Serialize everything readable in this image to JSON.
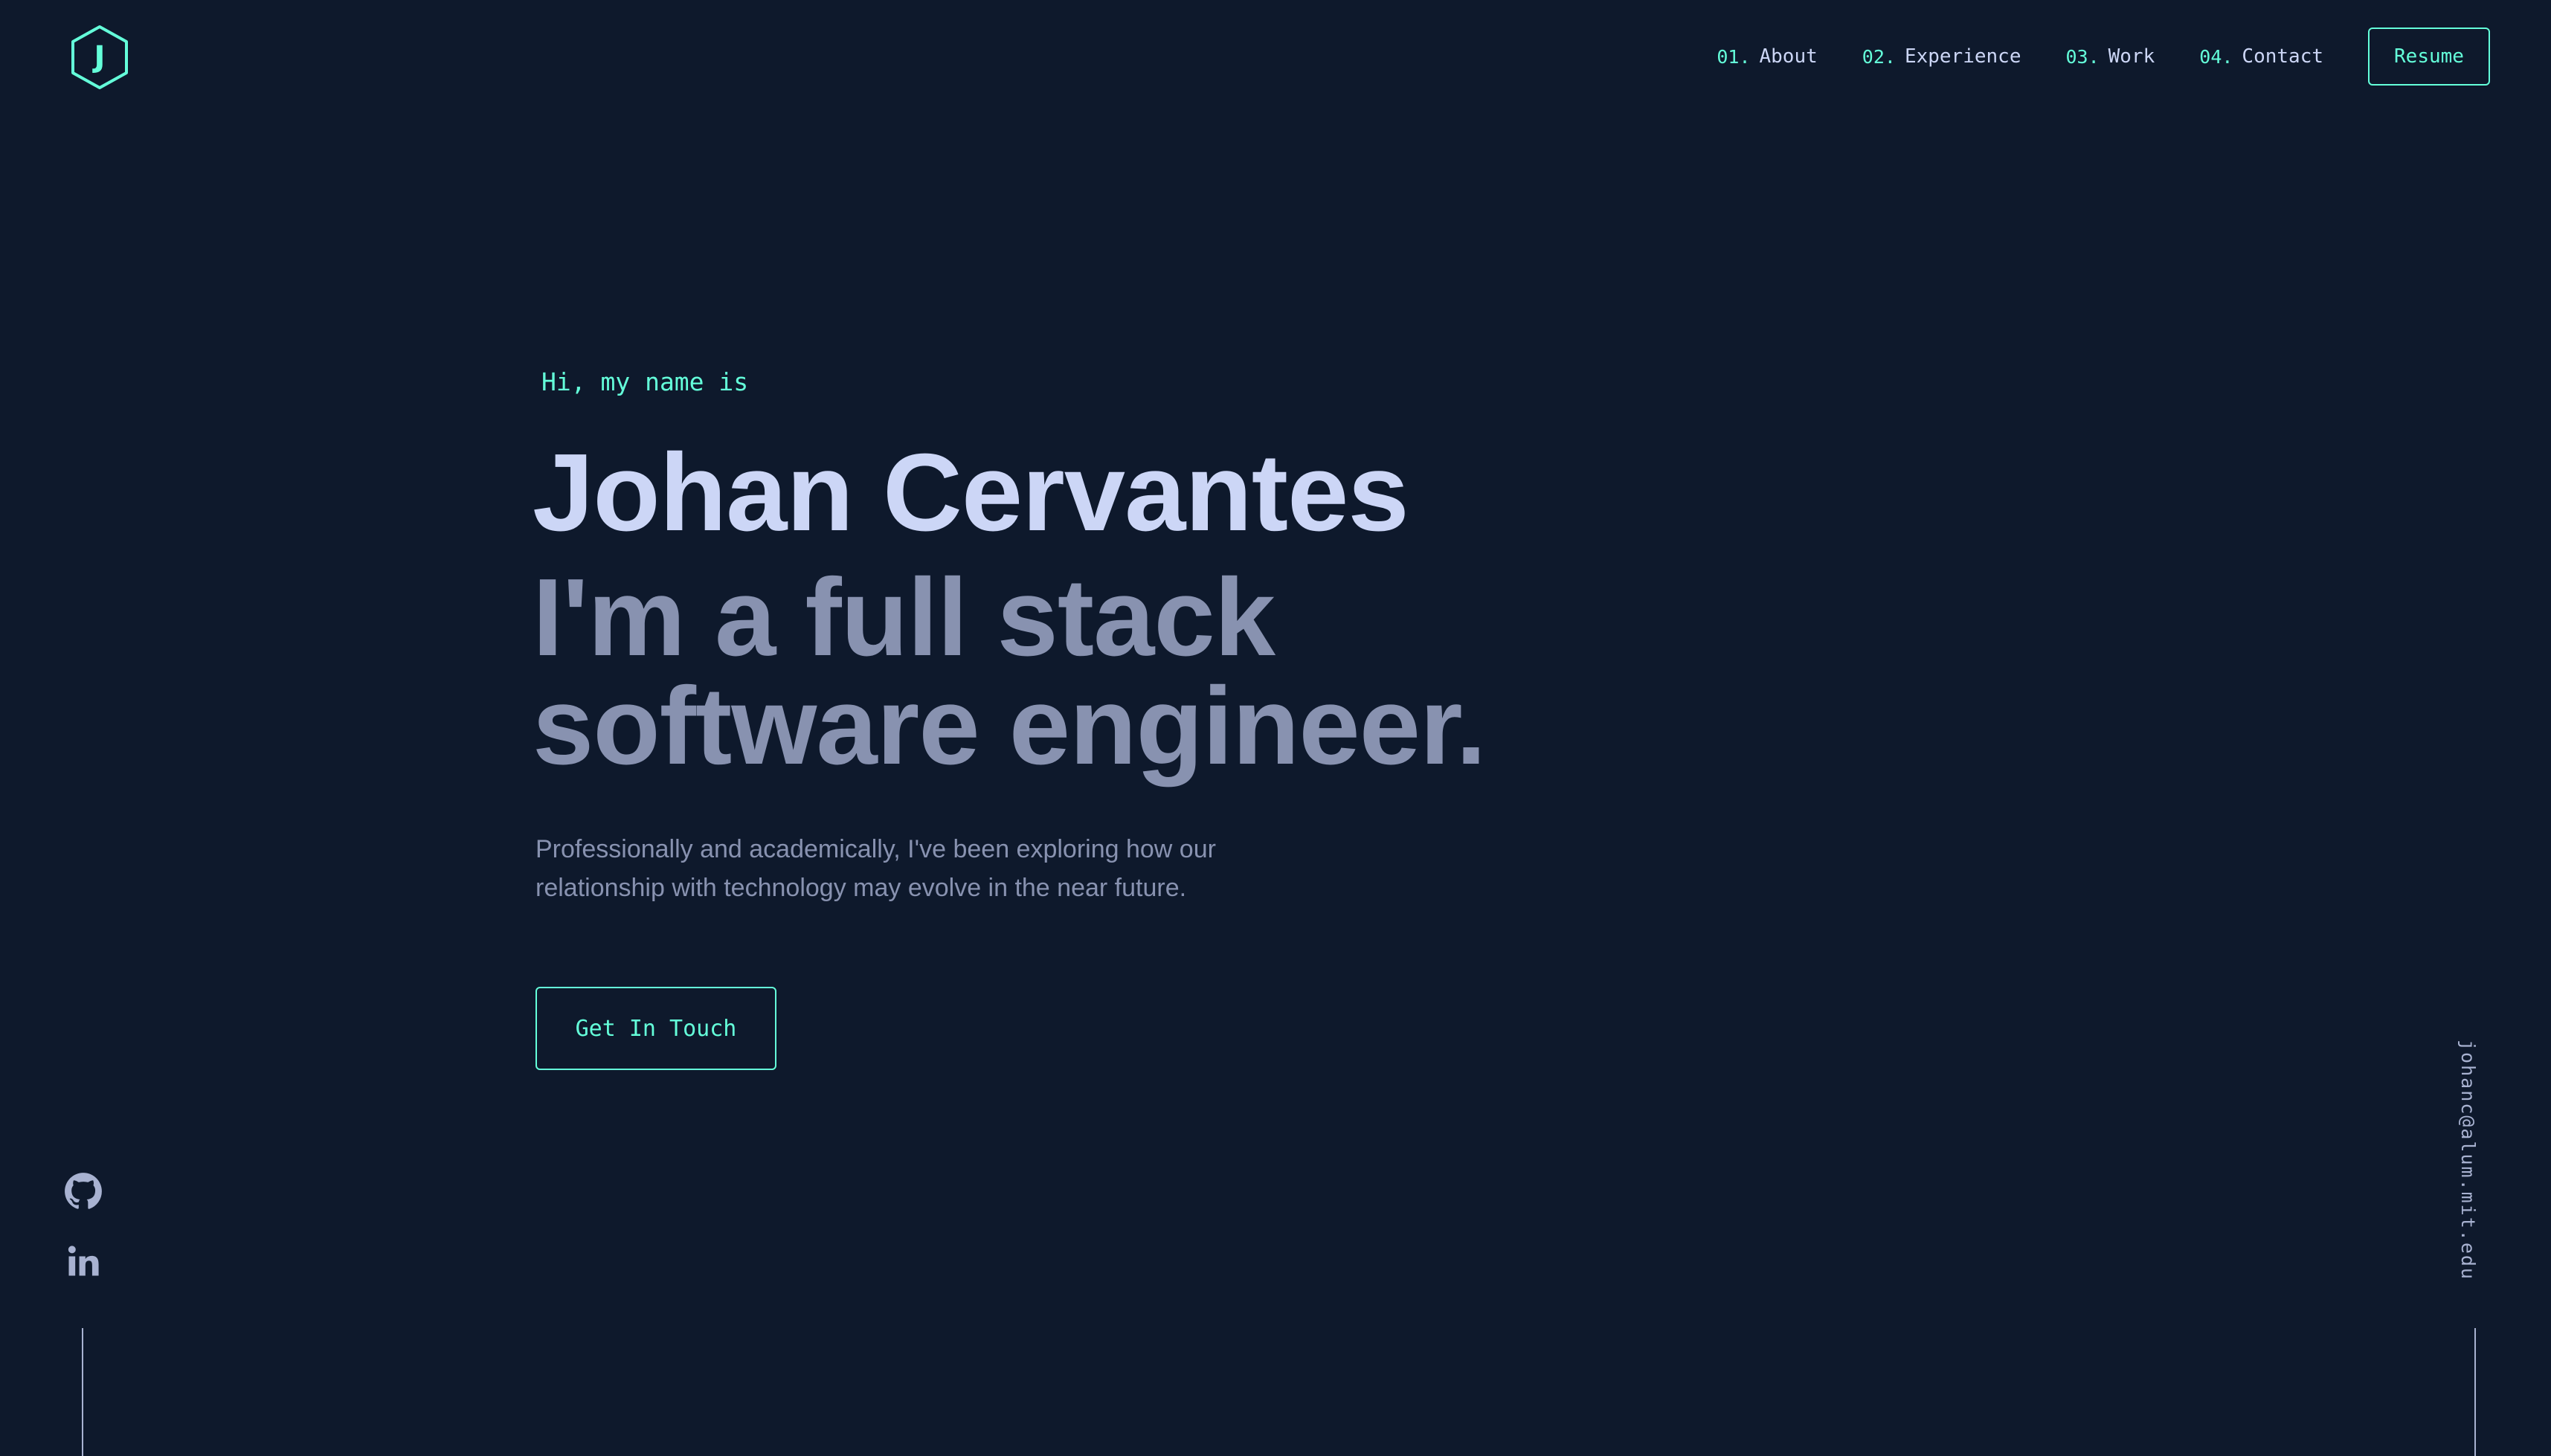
{
  "brand": {
    "logo_letter": "J",
    "logo_icon": "hexagon-logo-icon",
    "accent_color": "#64ffda",
    "background_color": "#0e192c"
  },
  "nav": {
    "items": [
      {
        "number": "01.",
        "label": "About"
      },
      {
        "number": "02.",
        "label": "Experience"
      },
      {
        "number": "03.",
        "label": "Work"
      },
      {
        "number": "04.",
        "label": "Contact"
      }
    ],
    "resume_label": "Resume"
  },
  "hero": {
    "greeting": "Hi, my name is",
    "name": "Johan Cervantes",
    "tagline": "I'm a full stack software engineer.",
    "description": "Professionally and academically, I've been exploring how our relationship with technology may evolve in the near future.",
    "cta_label": "Get In Touch"
  },
  "social": {
    "links": [
      {
        "icon": "github-icon"
      },
      {
        "icon": "linkedin-icon"
      }
    ]
  },
  "email": {
    "address": "johanc@alum.mit.edu"
  }
}
